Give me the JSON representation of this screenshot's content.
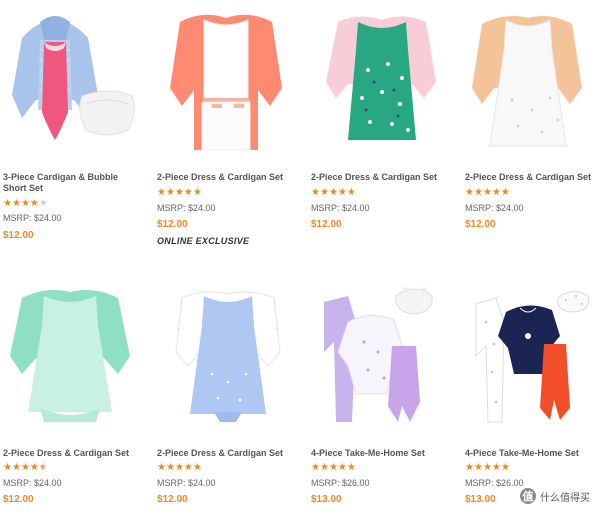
{
  "products": [
    {
      "title_lines": [
        "3-Piece Cardigan & Bubble",
        "Short Set"
      ],
      "rating": 4,
      "max_rating": 5,
      "msrp": "MSRP: $24.00",
      "price": "$12.00",
      "badge": "",
      "image": "blue-cardigan-pink-bodysuit-bubble-short"
    },
    {
      "title_lines": [
        "2-Piece Dress & Cardigan Set"
      ],
      "rating": 5,
      "max_rating": 5,
      "msrp": "MSRP: $24.00",
      "price": "$12.00",
      "badge": "ONLINE EXCLUSIVE",
      "image": "coral-cardigan-white-dress"
    },
    {
      "title_lines": [
        "2-Piece Dress & Cardigan Set"
      ],
      "rating": 5,
      "max_rating": 5,
      "msrp": "MSRP: $24.00",
      "price": "$12.00",
      "badge": "",
      "image": "pink-cardigan-teal-print-dress"
    },
    {
      "title_lines": [
        "2-Piece Dress & Cardigan Set"
      ],
      "rating": 5,
      "max_rating": 5,
      "msrp": "MSRP: $24.00",
      "price": "$12.00",
      "badge": "",
      "image": "peach-cardigan-white-print-dress"
    },
    {
      "title_lines": [
        "2-Piece Dress & Cardigan Set"
      ],
      "rating": 4.5,
      "max_rating": 5,
      "msrp": "MSRP: $24.00",
      "price": "$12.00",
      "badge": "",
      "image": "mint-cardigan-mint-dress"
    },
    {
      "title_lines": [
        "2-Piece Dress & Cardigan Set"
      ],
      "rating": 5,
      "max_rating": 5,
      "msrp": "MSRP: $24.00",
      "price": "$12.00",
      "badge": "",
      "image": "white-cardigan-blue-dress"
    },
    {
      "title_lines": [
        "4-Piece Take-Me-Home Set"
      ],
      "rating": 5,
      "max_rating": 5,
      "msrp": "MSRP: $26.00",
      "price": "$13.00",
      "badge": "",
      "image": "lavender-sleeper-bodysuit-pants-hat"
    },
    {
      "title_lines": [
        "4-Piece Take-Me-Home Set"
      ],
      "rating": 5,
      "max_rating": 5,
      "msrp": "MSRP: $26.00",
      "price": "$13.00",
      "badge": "",
      "image": "white-sleeper-navy-bodysuit-orange-pants-hat"
    }
  ],
  "colors": {
    "accent": "#f2871f",
    "star_off": "#cfcfcf"
  },
  "watermark": {
    "glyph": "值",
    "text": "什么值得买"
  }
}
